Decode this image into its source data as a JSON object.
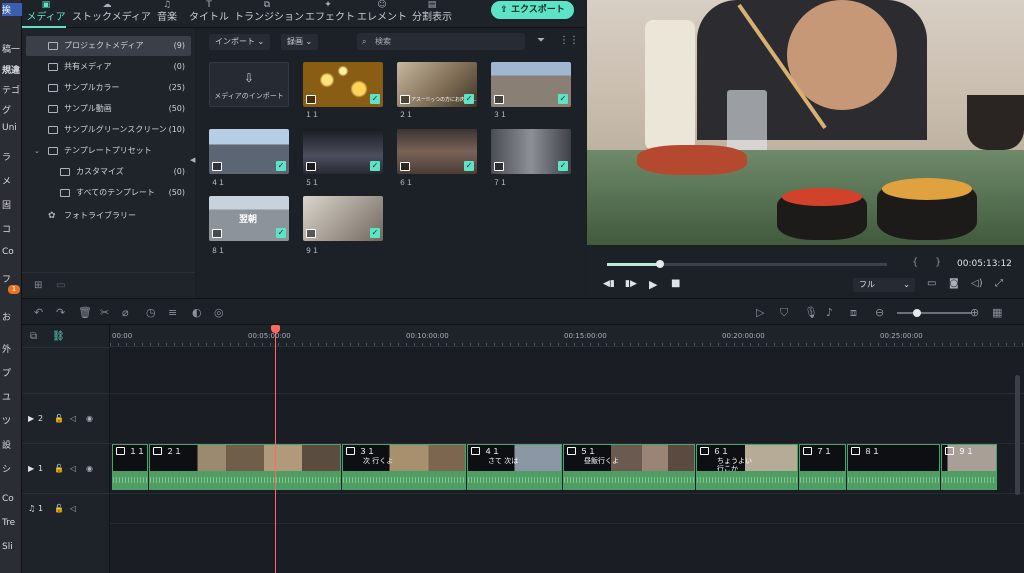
{
  "os_strip": {
    "labels": [
      "挨",
      "稿一",
      "規違",
      "テゴ",
      "グ",
      "Uni",
      "ラ",
      "メ",
      "固",
      "コ",
      "Co",
      "フ",
      "お",
      "外",
      "プ",
      "ユ",
      "ツ",
      "設",
      "シ",
      "Co",
      "Tre",
      "Sli"
    ],
    "badge": "1"
  },
  "top_tabs": [
    {
      "label": "メディア",
      "icon": "media-icon"
    },
    {
      "label": "ストックメディア",
      "icon": "cloud-icon"
    },
    {
      "label": "音楽",
      "icon": "music-icon"
    },
    {
      "label": "タイトル",
      "icon": "title-icon"
    },
    {
      "label": "トランジション",
      "icon": "transition-icon"
    },
    {
      "label": "エフェクト",
      "icon": "effect-icon"
    },
    {
      "label": "エレメント",
      "icon": "element-icon"
    },
    {
      "label": "分割表示",
      "icon": "split-icon"
    }
  ],
  "export_label": "エクスポート",
  "sidebar": {
    "items": [
      {
        "label": "プロジェクトメディア",
        "count": "(9)",
        "selected": true
      },
      {
        "label": "共有メディア",
        "count": "(0)"
      },
      {
        "label": "サンプルカラー",
        "count": "(25)"
      },
      {
        "label": "サンプル動画",
        "count": "(50)"
      },
      {
        "label": "サンプルグリーンスクリーン",
        "count": "(10)"
      },
      {
        "label": "テンプレートプリセット",
        "count": ""
      },
      {
        "label": "カスタマイズ",
        "count": "(0)"
      },
      {
        "label": "すべてのテンプレート",
        "count": "(50)"
      },
      {
        "label": "フォトライブラリー",
        "count": ""
      }
    ]
  },
  "media_panel": {
    "import_dropdown": "インポート",
    "record_dropdown": "録画",
    "search_placeholder": "検索",
    "import_tile": "メディアのインポート",
    "thumbnails": [
      {
        "label": "１１",
        "bg": "#b08a2a"
      },
      {
        "label": "２１",
        "bg": "#8d7b62",
        "overlay": "アスー!!っつの方にお肉 炎…"
      },
      {
        "label": "３１",
        "bg": "#6d7d8f"
      },
      {
        "label": "４１",
        "bg": "#7b8ea8"
      },
      {
        "label": "５１",
        "bg": "#3a3d46"
      },
      {
        "label": "６１",
        "bg": "#6a5b52"
      },
      {
        "label": "７１",
        "bg": "#5d6068"
      },
      {
        "label": "８１",
        "bg": "#8a9099",
        "overlay": "翌朝"
      },
      {
        "label": "９１",
        "bg": "#a59d94"
      }
    ]
  },
  "preview": {
    "timecode": "00:05:13:12",
    "quality": "フル",
    "progress": 0.19
  },
  "timeline": {
    "ruler": [
      "00:00",
      "00:05:00:00",
      "00:10:00:00",
      "00:15:00:00",
      "00:20:00:00",
      "00:25:00:00"
    ],
    "tracks": [
      {
        "label": "2",
        "kind": "video"
      },
      {
        "label": "1",
        "kind": "video"
      },
      {
        "label": "1",
        "kind": "audio"
      }
    ],
    "clips": [
      {
        "label": "１１",
        "overlay": ""
      },
      {
        "label": "２１",
        "overlay": ""
      },
      {
        "label": "３１",
        "overlay": "次 行くよ"
      },
      {
        "label": "４１",
        "overlay": "さて 次は"
      },
      {
        "label": "５１",
        "overlay": "昼飯行くよ"
      },
      {
        "label": "６１",
        "overlay": "ちょうよい 行こか"
      },
      {
        "label": "７１",
        "overlay": ""
      },
      {
        "label": "８１",
        "overlay": ""
      },
      {
        "label": "９１",
        "overlay": ""
      }
    ]
  },
  "colors": {
    "accent": "#5fe3c6",
    "playhead": "#ff6b5b",
    "clip_audio": "#4f9d64"
  }
}
